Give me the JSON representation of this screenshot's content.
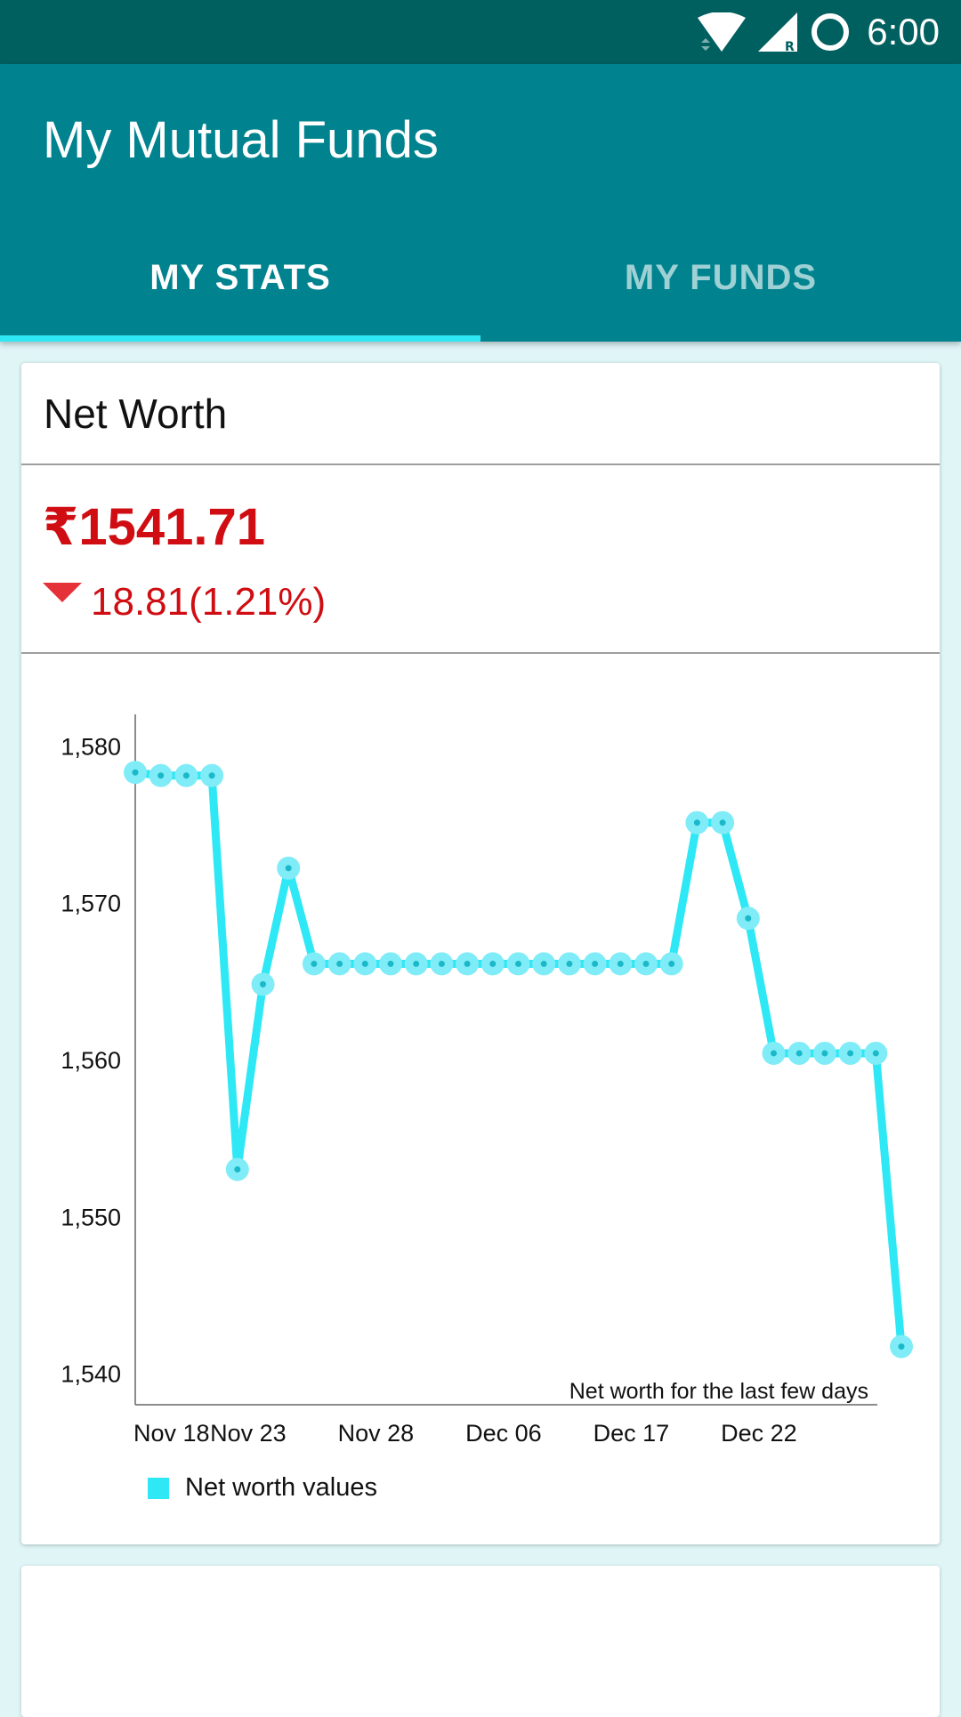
{
  "status_bar": {
    "time": "6:00",
    "icons": [
      "wifi-icon",
      "signal-icon",
      "circle-icon"
    ]
  },
  "app_bar": {
    "title": "My Mutual Funds",
    "tabs": [
      {
        "label": "MY STATS",
        "active": true
      },
      {
        "label": "MY FUNDS",
        "active": false
      }
    ]
  },
  "net_worth_card": {
    "title": "Net Worth",
    "value": "₹1541.71",
    "change": "18.81(1.21%)",
    "change_direction": "down"
  },
  "colors": {
    "primary": "#00838f",
    "primary_dark": "#00605f",
    "accent": "#2ee8f5",
    "negative": "#cf0d12"
  },
  "chart_data": {
    "type": "line",
    "description": "Net worth for the last few days",
    "y_ticks": [
      "1,580",
      "1,570",
      "1,560",
      "1,550",
      "1,540"
    ],
    "x_ticks": [
      "Nov 18",
      "Nov 23",
      "Nov 28",
      "Dec 06",
      "Dec 17",
      "Dec 22"
    ],
    "ylim": [
      1538,
      1582
    ],
    "legend": "bottom-left",
    "series": [
      {
        "name": "Net worth values",
        "color": "#2ee8f5",
        "values": [
          1578.3,
          1578.1,
          1578.1,
          1578.1,
          1553.0,
          1564.8,
          1572.2,
          1566.1,
          1566.1,
          1566.1,
          1566.1,
          1566.1,
          1566.1,
          1566.1,
          1566.1,
          1566.1,
          1566.1,
          1566.1,
          1566.1,
          1566.1,
          1566.1,
          1566.1,
          1575.1,
          1575.1,
          1569.0,
          1560.4,
          1560.4,
          1560.4,
          1560.4,
          1560.4,
          1541.71
        ]
      }
    ]
  }
}
